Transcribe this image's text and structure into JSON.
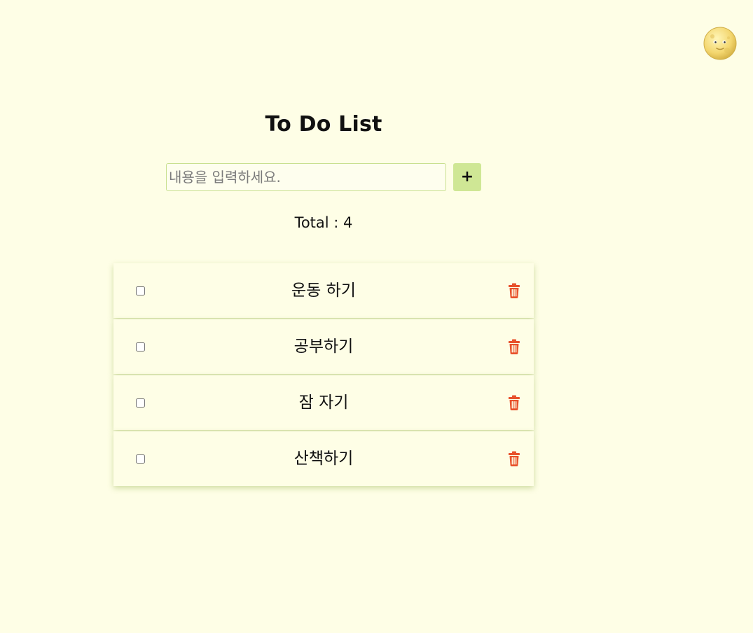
{
  "theme_toggle": {
    "icon": "moon-face-icon"
  },
  "header": {
    "title": "To Do List"
  },
  "new_todo": {
    "placeholder": "내용을 입력하세요.",
    "value": "",
    "add_label": "+"
  },
  "total": {
    "label": "Total : 4"
  },
  "todos": [
    {
      "text": "운동 하기",
      "checked": false
    },
    {
      "text": "공부하기",
      "checked": false
    },
    {
      "text": "잠 자기",
      "checked": false
    },
    {
      "text": "산책하기",
      "checked": false
    }
  ],
  "colors": {
    "background": "#fefee6",
    "accent": "#cfe795",
    "input_border": "#c9e08f",
    "delete": "#e8512b"
  }
}
